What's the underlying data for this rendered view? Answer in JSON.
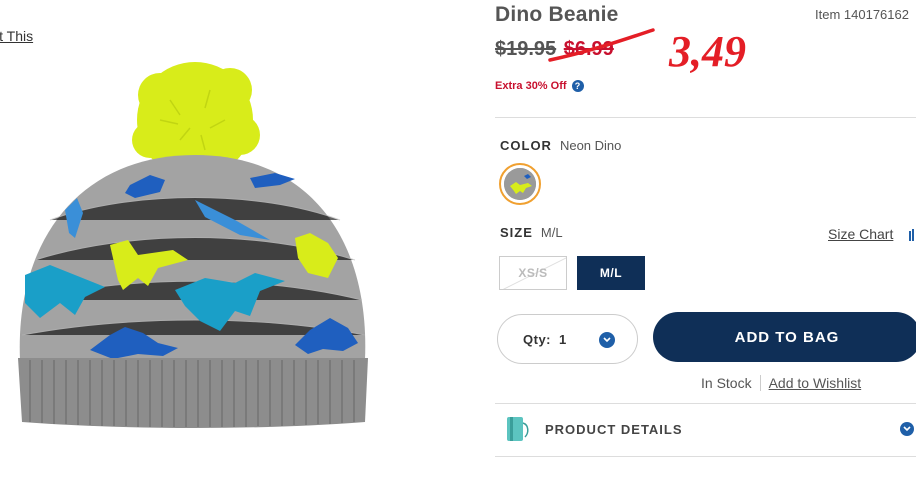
{
  "zoom_link": "it This",
  "product": {
    "title": "Dino Beanie",
    "item_number": "Item 140176162",
    "original_price": "$19.95",
    "sale_price": "$6.99",
    "handwritten_price": "3,49",
    "promo": "Extra 30% Off",
    "help_glyph": "?"
  },
  "color": {
    "label": "COLOR",
    "value": "Neon Dino"
  },
  "size": {
    "label": "SIZE",
    "value": "M/L",
    "chart_link": "Size Chart",
    "options": [
      "XS/S",
      "M/L"
    ]
  },
  "qty": {
    "label": "Qty:",
    "value": "1"
  },
  "add_to_bag": "ADD TO BAG",
  "in_stock": "In Stock",
  "wishlist": "Add to Wishlist",
  "details": "PRODUCT DETAILS",
  "colors": {
    "navy": "#0f2f57",
    "accent_blue": "#1f5fa8",
    "sale_red": "#c8102e",
    "ink_red": "#e41e26",
    "swatch_ring": "#f0a030",
    "neon": "#d8ec1a"
  }
}
